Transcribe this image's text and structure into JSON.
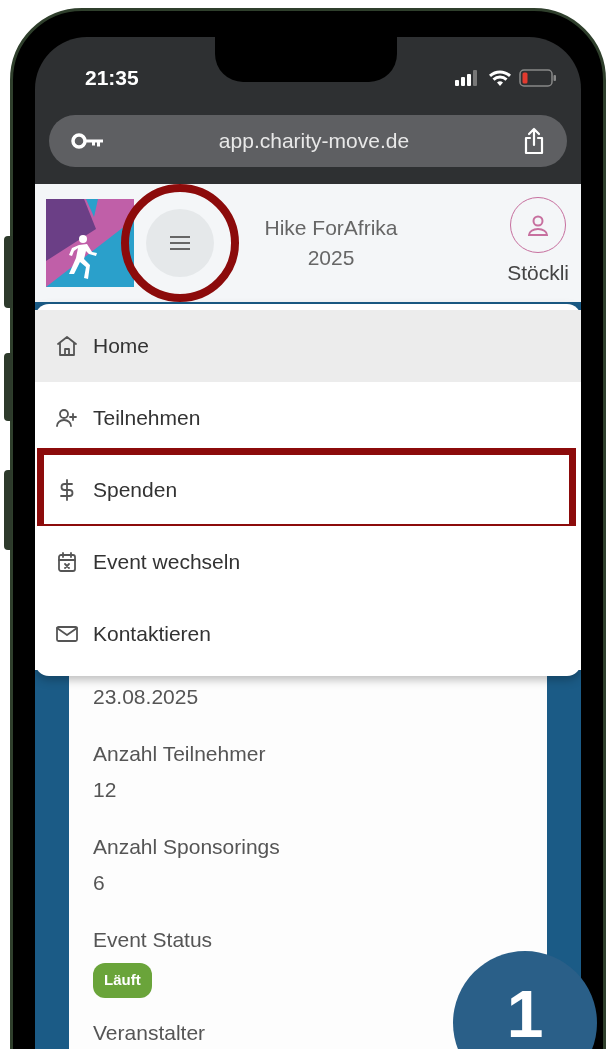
{
  "status_bar": {
    "time": "21:35"
  },
  "browser": {
    "url": "app.charity-move.de"
  },
  "header": {
    "event_title": "Hike ForAfrika 2025",
    "user_name": "Stöckli",
    "menu_button_circled": true
  },
  "menu": {
    "items": [
      {
        "label": "Home",
        "selected": true,
        "highlighted": false
      },
      {
        "label": "Teilnehmen",
        "selected": false,
        "highlighted": false
      },
      {
        "label": "Spenden",
        "selected": false,
        "highlighted": true
      },
      {
        "label": "Event wechseln",
        "selected": false,
        "highlighted": false
      },
      {
        "label": "Kontaktieren",
        "selected": false,
        "highlighted": false
      }
    ]
  },
  "card": {
    "fields": [
      {
        "kind": "text",
        "value": "23.08.2025"
      },
      {
        "kind": "text",
        "label": "Anzahl Teilnehmer",
        "value": "12"
      },
      {
        "kind": "text",
        "label": "Anzahl Sponsorings",
        "value": "6"
      },
      {
        "kind": "badge",
        "label": "Event Status",
        "value": "Läuft",
        "color": "#6aa43a"
      },
      {
        "kind": "text",
        "label": "Veranstalter"
      }
    ]
  },
  "step_badge": "1"
}
